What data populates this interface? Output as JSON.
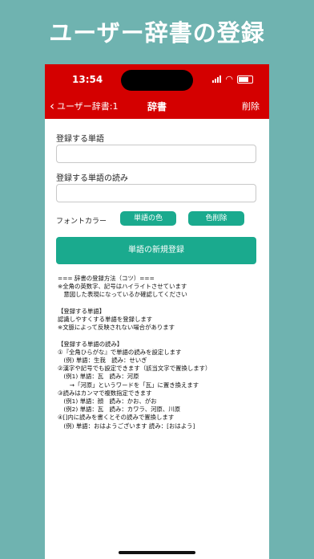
{
  "promo_title": "ユーザー辞書の登録",
  "status": {
    "time": "13:54"
  },
  "nav": {
    "back_label": "ユーザー辞書:1",
    "title": "辞書",
    "delete_label": "削除"
  },
  "form": {
    "word_label": "登録する単語",
    "word_value": "",
    "reading_label": "登録する単語の読み",
    "reading_value": "",
    "font_color_label": "フォントカラー",
    "word_color_button": "単語の色",
    "color_delete_button": "色削除",
    "register_button": "単語の新規登録"
  },
  "help_lines": [
    "=== 辞書の登録方法（コツ）===",
    "※全角の英数字、記号はハイライトさせています",
    "　意図した表現になっているか確認してください",
    "",
    "【登録する単語】",
    "認識しやすくする単語を登録します",
    "※文脈によって反映されない場合があります",
    "",
    "【登録する単語の読み】",
    "①『全角ひらがな』で単語の読みを設定します",
    "　(例) 単語：生我　読み：せいぎ",
    "②漢字や記号でも設定できます（該当文字で置換します）",
    "　(例1) 単語：瓦　読み：河原",
    "　　→「河原」というワードを「瓦」に置き換えます",
    "③読みはカンマで複数指定できます",
    "　(例1) 単語：顔　読み：かお、がお",
    "　(例2) 単語：瓦　読み：カワラ、河原、川原",
    "④[]内に読みを書くとその読みで置換します",
    "　(例) 単語：おはようございます 読み：[おはよう]"
  ],
  "colors": {
    "brand_red": "#d40000",
    "accent_green": "#1aaa8e",
    "background": "#6fb3b0"
  }
}
